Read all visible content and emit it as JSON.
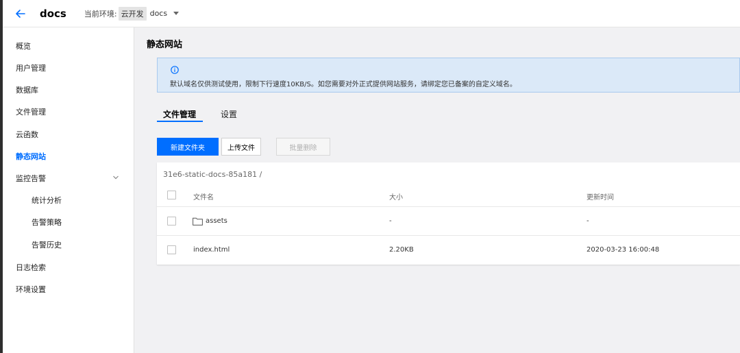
{
  "header": {
    "title": "docs",
    "env_label": "当前环境:",
    "env_chip": "云开发",
    "env_name": "docs"
  },
  "sidebar": {
    "items": [
      {
        "label": "概览"
      },
      {
        "label": "用户管理"
      },
      {
        "label": "数据库"
      },
      {
        "label": "文件管理"
      },
      {
        "label": "云函数"
      },
      {
        "label": "静态网站",
        "active": true
      },
      {
        "label": "监控告警",
        "expanded": true
      },
      {
        "label": "统计分析",
        "sub": true
      },
      {
        "label": "告警策略",
        "sub": true
      },
      {
        "label": "告警历史",
        "sub": true
      },
      {
        "label": "日志检索"
      },
      {
        "label": "环境设置"
      }
    ]
  },
  "main": {
    "page_title": "静态网站",
    "alert": {
      "text": "默认域名仅供测试使用，限制下行速度10KB/S。如您需要对外正式提供网站服务，请绑定您已备案的自定义域名。"
    },
    "tabs": [
      {
        "label": "文件管理",
        "active": true
      },
      {
        "label": "设置"
      }
    ],
    "buttons": {
      "new_folder": "新建文件夹",
      "upload": "上传文件",
      "batch_delete": "批量删除"
    },
    "file_table": {
      "path": "31e6-static-docs-85a181 /",
      "columns": [
        "文件名",
        "大小",
        "更新时间"
      ],
      "rows": [
        {
          "name": "assets",
          "type": "folder",
          "size": "-",
          "updated": "-"
        },
        {
          "name": "index.html",
          "type": "file",
          "size": "2.20KB",
          "updated": "2020-03-23 16:00:48"
        }
      ]
    }
  },
  "colors": {
    "accent": "#006eff",
    "alert_bg": "#dbe9f8",
    "alert_border": "#a8c9ee"
  }
}
